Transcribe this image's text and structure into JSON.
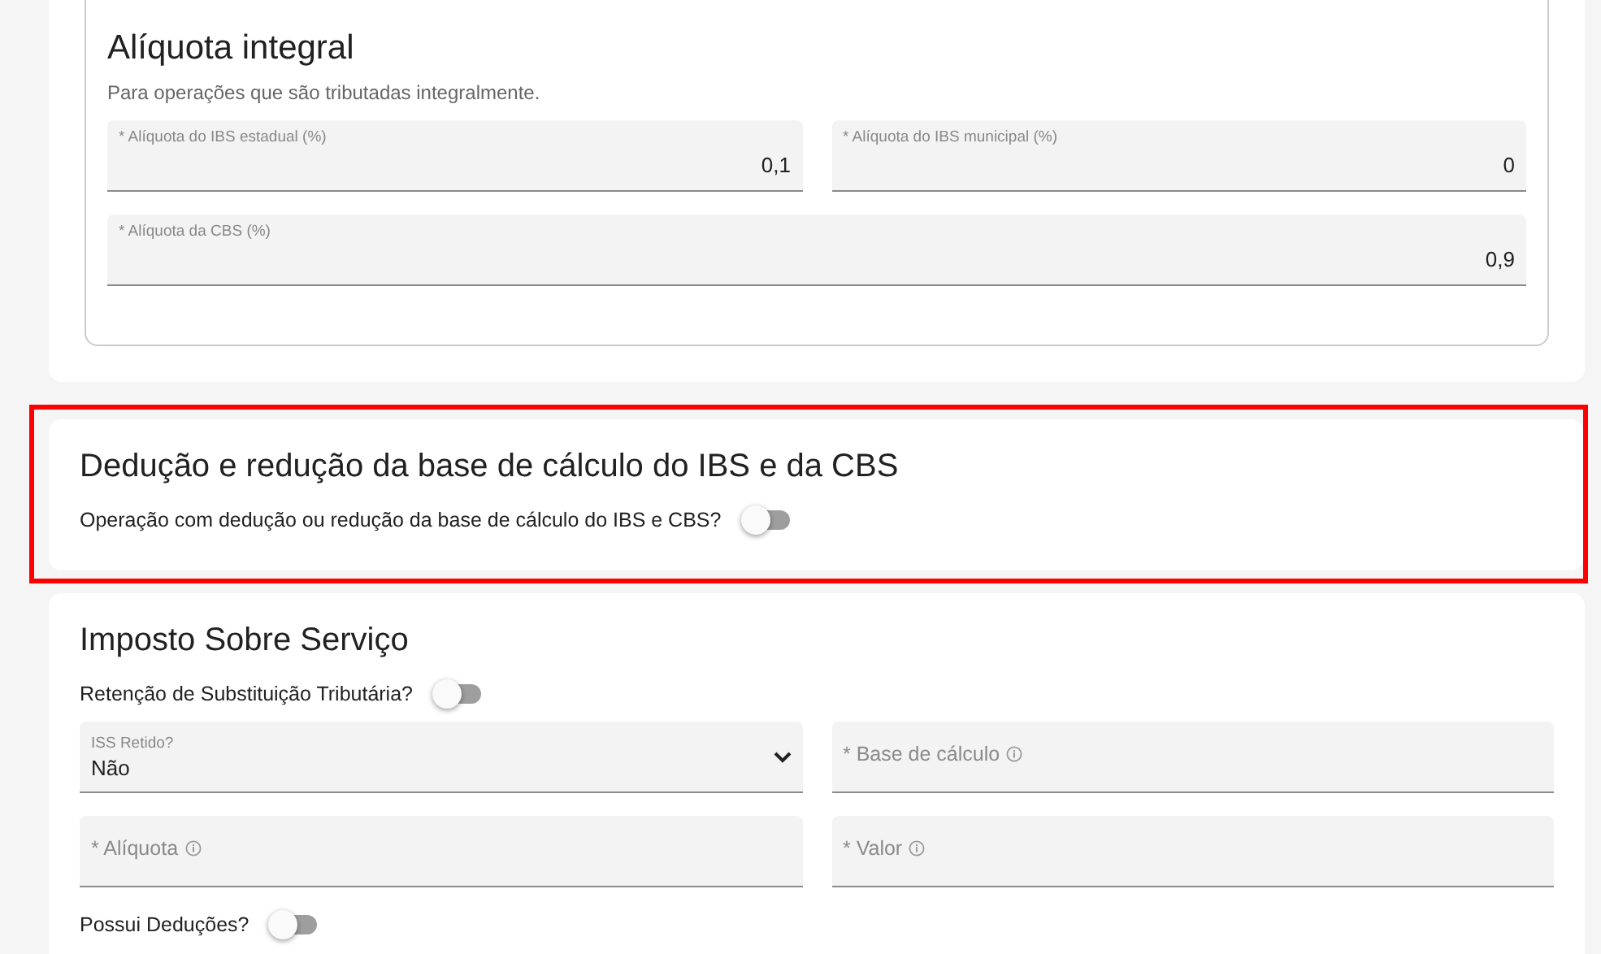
{
  "sections": [
    {
      "kind": "boxed",
      "title": "Alíquota integral",
      "subtitle": "Para operações que são tributadas integralmente.",
      "highlighted": false,
      "rows": [
        [
          {
            "kind": "number",
            "label": "* Alíquota do IBS estadual (%)",
            "value": "0,1"
          },
          {
            "kind": "number",
            "label": "* Alíquota do IBS municipal (%)",
            "value": "0"
          }
        ],
        [
          {
            "kind": "number",
            "label": "* Alíquota da CBS (%)",
            "value": "0,9"
          }
        ]
      ]
    },
    {
      "kind": "plain",
      "title": "Dedução e redução da base de cálculo do IBS e da CBS",
      "highlighted": true,
      "rows": [
        [
          {
            "kind": "toggle",
            "label": "Operação com dedução ou redução da base de cálculo do IBS e CBS?",
            "on": false
          }
        ]
      ]
    },
    {
      "kind": "plain",
      "title": "Imposto Sobre Serviço",
      "highlighted": false,
      "rows": [
        [
          {
            "kind": "toggle",
            "label": "Retenção de Substituição Tributária?",
            "on": false
          }
        ],
        [
          {
            "kind": "select",
            "label": "ISS Retido?",
            "value": "Não"
          },
          {
            "kind": "number",
            "label": "* Base de cálculo",
            "info": true
          }
        ],
        [
          {
            "kind": "number",
            "label": "* Alíquota",
            "info": true
          },
          {
            "kind": "number",
            "label": "* Valor",
            "info": true
          }
        ],
        [
          {
            "kind": "toggle",
            "label": "Possui Deduções?",
            "on": false
          }
        ]
      ]
    }
  ]
}
